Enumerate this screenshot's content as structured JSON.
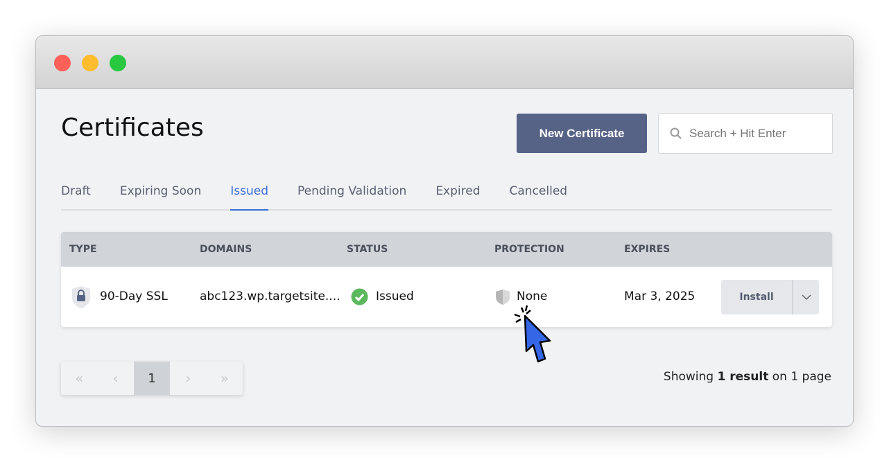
{
  "page": {
    "title": "Certificates",
    "new_button": "New Certificate",
    "search_placeholder": "Search + Hit Enter"
  },
  "tabs": [
    {
      "label": "Draft"
    },
    {
      "label": "Expiring Soon"
    },
    {
      "label": "Issued",
      "active": true
    },
    {
      "label": "Pending Validation"
    },
    {
      "label": "Expired"
    },
    {
      "label": "Cancelled"
    }
  ],
  "table": {
    "headers": [
      "TYPE",
      "DOMAINS",
      "STATUS",
      "PROTECTION",
      "EXPIRES"
    ],
    "rows": [
      {
        "type": "90-Day SSL",
        "domain": "abc123.wp.targetsite....",
        "status": "Issued",
        "protection": "None",
        "expires": "Mar 3, 2025",
        "action": "Install"
      }
    ]
  },
  "pagination": {
    "current": "1",
    "showing_prefix": "Showing",
    "showing_bold": "1 result",
    "showing_suffix": "on 1 page"
  },
  "colors": {
    "accent": "#3b6fd6",
    "button": "#576386",
    "success": "#5cb85c"
  }
}
